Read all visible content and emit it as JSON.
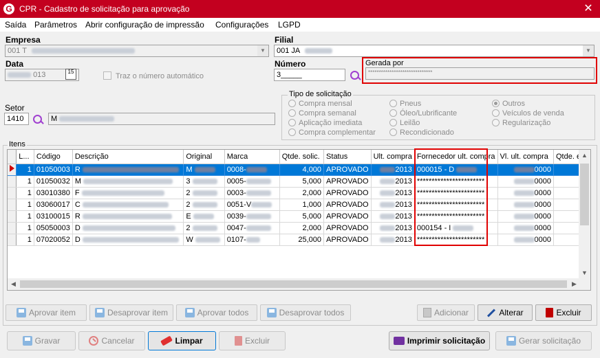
{
  "window": {
    "title": "CPR - Cadastro de solicitação para aprovação",
    "close": "✕",
    "icon": "G"
  },
  "menu": [
    "Saída",
    "Parâmetros",
    "Abrir configuração de impressão",
    "Configurações",
    "LGPD"
  ],
  "form": {
    "empresa_label": "Empresa",
    "empresa_value": "001 T",
    "filial_label": "Filial",
    "filial_value": "001 JA",
    "data_label": "Data",
    "data_value": "013",
    "calendar_text": "15",
    "traz_numero_label": "Traz o número automático",
    "numero_label": "Número",
    "numero_value": "3_____",
    "gerada_por_label": "Gerada por",
    "gerada_por_value": "******************************",
    "setor_label": "Setor",
    "setor_code": "1410",
    "setor_name": "M"
  },
  "tipo_solicitacao": {
    "title": "Tipo de solicitação",
    "options": [
      {
        "label": "Compra mensal",
        "selected": false
      },
      {
        "label": "Compra semanal",
        "selected": false
      },
      {
        "label": "Aplicação imediata",
        "selected": false
      },
      {
        "label": "Compra complementar",
        "selected": false
      },
      {
        "label": "Pneus",
        "selected": false
      },
      {
        "label": "Óleo/Lubrificante",
        "selected": false
      },
      {
        "label": "Leilão",
        "selected": false
      },
      {
        "label": "Recondicionado",
        "selected": false
      },
      {
        "label": "Outros",
        "selected": true
      },
      {
        "label": "Veículos de venda",
        "selected": false
      },
      {
        "label": "Regularização",
        "selected": false
      }
    ]
  },
  "itens": {
    "title": "Itens",
    "columns": [
      "L...",
      "Código",
      "Descrição",
      "Original",
      "Marca",
      "Qtde. solic.",
      "Status",
      "Ult. compra",
      "Fornecedor ult. compra",
      "Vl. ult. compra",
      "Qtde. est"
    ],
    "rows": [
      {
        "l": "1",
        "codigo": "01050003",
        "descricao": "R",
        "original": "M",
        "marca": "0008-",
        "qtde": "4,000",
        "status": "APROVADO",
        "ult": "2013",
        "fornecedor": "000015 - D",
        "vl": "0000"
      },
      {
        "l": "1",
        "codigo": "01050032",
        "descricao": "M",
        "original": "3",
        "marca": "0005-",
        "qtde": "5,000",
        "status": "APROVADO",
        "ult": "2013",
        "fornecedor": "***********************",
        "vl": "0000"
      },
      {
        "l": "1",
        "codigo": "03010380",
        "descricao": "F",
        "original": "2",
        "marca": "0003-",
        "qtde": "2,000",
        "status": "APROVADO",
        "ult": "2013",
        "fornecedor": "***********************",
        "vl": "0000"
      },
      {
        "l": "1",
        "codigo": "03060017",
        "descricao": "C",
        "original": "2",
        "marca": "0051-V",
        "qtde": "1,000",
        "status": "APROVADO",
        "ult": "2013",
        "fornecedor": "***********************",
        "vl": "0000"
      },
      {
        "l": "1",
        "codigo": "03100015",
        "descricao": "R",
        "original": "E",
        "marca": "0039-",
        "qtde": "5,000",
        "status": "APROVADO",
        "ult": "2013",
        "fornecedor": "***********************",
        "vl": "0000"
      },
      {
        "l": "1",
        "codigo": "05050003",
        "descricao": "D",
        "original": "2",
        "marca": "0047-",
        "qtde": "2,000",
        "status": "APROVADO",
        "ult": "2013",
        "fornecedor": "000154 - I",
        "vl": "0000"
      },
      {
        "l": "1",
        "codigo": "07020052",
        "descricao": "D",
        "original": "W",
        "marca": "0107-",
        "qtde": "25,000",
        "status": "APROVADO",
        "ult": "2013",
        "fornecedor": "***********************",
        "vl": "0000"
      }
    ]
  },
  "item_buttons": {
    "aprovar_item": "Aprovar item",
    "desaprovar_item": "Desaprovar item",
    "aprovar_todos": "Aprovar todos",
    "desaprovar_todos": "Desaprovar todos",
    "adicionar": "Adicionar",
    "alterar": "Alterar",
    "excluir": "Excluir"
  },
  "footer_buttons": {
    "gravar": "Gravar",
    "cancelar": "Cancelar",
    "limpar": "Limpar",
    "excluir": "Excluir",
    "imprimir": "Imprimir solicitação",
    "gerar": "Gerar solicitação"
  },
  "colors": {
    "title_bar": "#c3001f",
    "selection": "#0078d7",
    "highlight_box": "#e00000",
    "search_icon": "#a040d0"
  }
}
